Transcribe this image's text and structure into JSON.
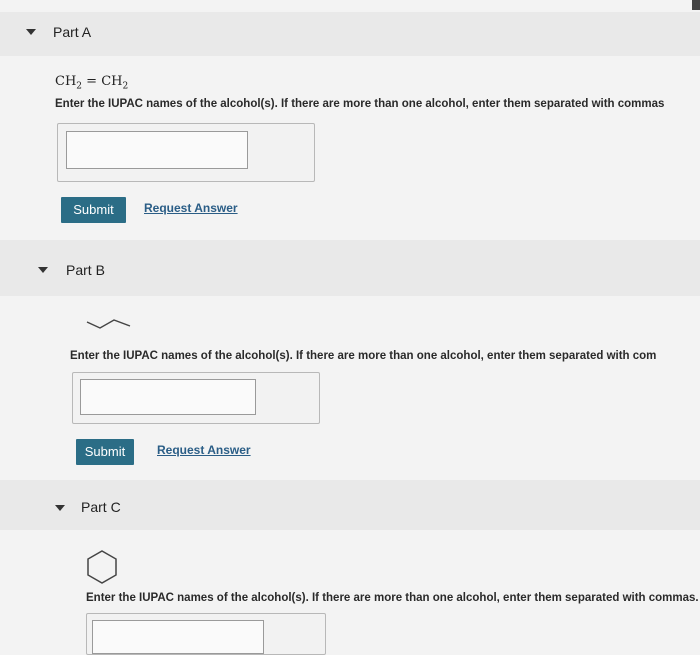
{
  "part_a": {
    "title": "Part A",
    "formula": {
      "lhs": "CH",
      "lhs_sub": "2",
      "op": " = ",
      "rhs": "CH",
      "rhs_sub": "2"
    },
    "prompt": "Enter the IUPAC names of the alcohol(s). If there are more than one alcohol, enter them separated with commas",
    "input_value": "",
    "submit_label": "Submit",
    "request_label": "Request Answer"
  },
  "part_b": {
    "title": "Part B",
    "prompt": "Enter the IUPAC names of the alcohol(s). If there are more than one alcohol, enter them separated with com",
    "input_value": "",
    "submit_label": "Submit",
    "request_label": "Request Answer"
  },
  "part_c": {
    "title": "Part C",
    "prompt": "Enter the IUPAC names of the alcohol(s). If there are more than one alcohol, enter them separated with commas.",
    "input_value": ""
  },
  "colors": {
    "button_bg": "#2b6d86",
    "link": "#2a5d86"
  }
}
